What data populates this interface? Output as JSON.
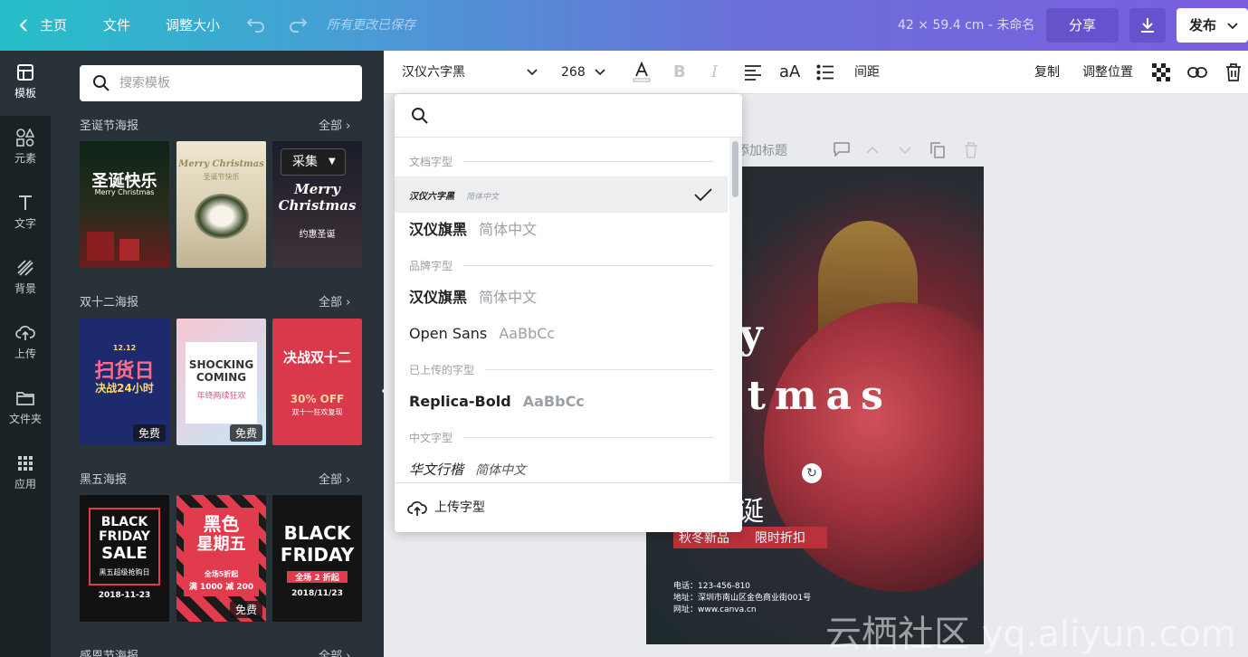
{
  "topbar": {
    "home": "主页",
    "file": "文件",
    "resize": "调整大小",
    "saved_status": "所有更改已保存",
    "doc_info": "42 × 59.4 cm - 未命名",
    "share": "分享",
    "publish": "发布"
  },
  "rail": {
    "items": [
      {
        "label": "模板",
        "icon": "template-icon"
      },
      {
        "label": "元素",
        "icon": "elements-icon"
      },
      {
        "label": "文字",
        "icon": "text-icon"
      },
      {
        "label": "背景",
        "icon": "background-icon"
      },
      {
        "label": "上传",
        "icon": "upload-icon"
      },
      {
        "label": "文件夹",
        "icon": "folder-icon"
      },
      {
        "label": "应用",
        "icon": "apps-icon"
      }
    ]
  },
  "panel": {
    "search_placeholder": "搜索模板",
    "see_all": "全部",
    "collect": "采集",
    "free": "免费",
    "sections": [
      {
        "title": "圣诞节海报",
        "thumbs": [
          {
            "lines": [
              "圣诞快乐",
              "Merry Christmas"
            ]
          },
          {
            "lines": [
              "Merry Christmas",
              "圣诞节快乐"
            ]
          },
          {
            "lines": [
              "Merry",
              "Christmas",
              "约惠圣诞"
            ]
          }
        ]
      },
      {
        "title": "双十二海报",
        "thumbs": [
          {
            "lines": [
              "12.12",
              "扫货日",
              "决战24小时"
            ]
          },
          {
            "lines": [
              "SHOCKING",
              "COMING",
              "年终两续狂欢"
            ]
          },
          {
            "lines": [
              "决战双十二",
              "30% OFF",
              "双十一狂欢复现"
            ]
          }
        ]
      },
      {
        "title": "黑五海报",
        "thumbs": [
          {
            "lines": [
              "BLACK",
              "FRIDAY",
              "SALE",
              "黑五超级抢购日",
              "2018-11-23"
            ]
          },
          {
            "lines": [
              "黑色",
              "星期五",
              "全场5折起",
              "满 1000 减 200"
            ]
          },
          {
            "lines": [
              "BLACK",
              "FRIDAY",
              "全场 2 折起",
              "2018/11/23"
            ]
          }
        ]
      },
      {
        "title": "感恩节海报"
      }
    ]
  },
  "toolbar": {
    "font_name": "汉仪六字黑",
    "font_size": "268",
    "spacing": "间距",
    "case_label": "aA",
    "copy": "复制",
    "position": "调整位置"
  },
  "fontmenu": {
    "sections": [
      {
        "title": "文档字型"
      },
      {
        "title": "品牌字型"
      },
      {
        "title": "已上传的字型"
      },
      {
        "title": "中文字型"
      }
    ],
    "items": [
      {
        "name": "汉仪六字黑",
        "preview": "简体中文"
      },
      {
        "name": "汉仪旗黑",
        "preview": "简体中文"
      },
      {
        "name": "汉仪旗黑",
        "preview": "简体中文"
      },
      {
        "name": "Open Sans",
        "preview": "AaBbCc"
      },
      {
        "name": "Replica-Bold",
        "preview": "AaBbCc"
      },
      {
        "name": "华文行楷",
        "preview": "简体中文"
      }
    ],
    "upload": "上传字型"
  },
  "canvas": {
    "page_title": "添加标题",
    "poster": {
      "merry": "Merry",
      "christmas": "Christmas",
      "title_cn": "圣诞",
      "tag1": "秋冬新品",
      "tag2": "限时折扣",
      "phone": "电话：123-456-810",
      "address": "地址：深圳市南山区金色商业街001号",
      "website": "网址：www.canva.cn"
    }
  },
  "watermark": "云栖社区 yq.aliyun.com",
  "colors": {
    "accent": "#7b5ee0",
    "rail_bg": "#1b2226",
    "panel_bg": "#293239",
    "poster_red": "#b8313b"
  }
}
